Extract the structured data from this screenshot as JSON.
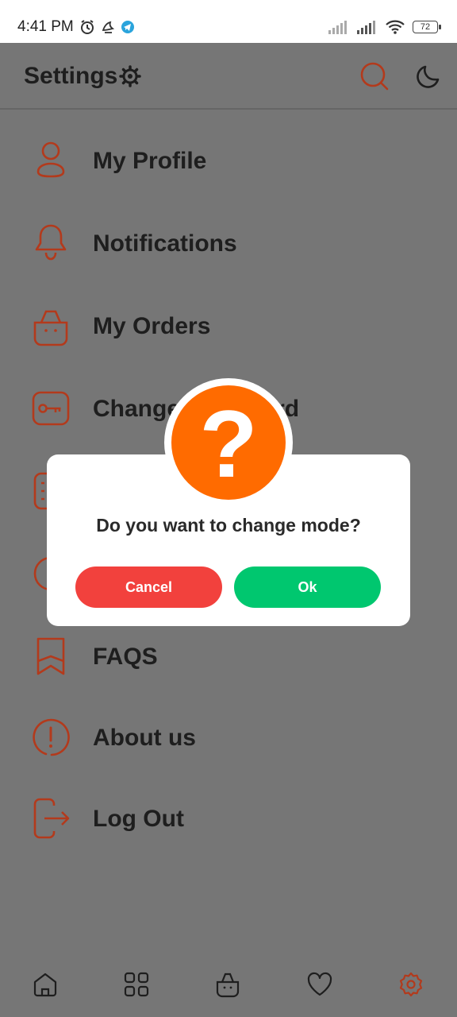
{
  "status_bar": {
    "time": "4:41 PM",
    "battery": "72",
    "icons": [
      "alarm-icon",
      "app-notification-icon",
      "telegram-icon",
      "signal-icon",
      "signal-icon",
      "wifi-icon",
      "battery-icon"
    ]
  },
  "header": {
    "title": "Settings",
    "icons": [
      "gear-icon",
      "search-icon",
      "moon-icon"
    ]
  },
  "menu": {
    "items": [
      {
        "label": "My Profile",
        "icon": "user-icon"
      },
      {
        "label": "Notifications",
        "icon": "bell-icon"
      },
      {
        "label": "My Orders",
        "icon": "bag-icon"
      },
      {
        "label": "Change Password",
        "icon": "key-icon"
      },
      {
        "label": "",
        "icon": "document-icon"
      },
      {
        "label": "",
        "icon": "circle-icon"
      },
      {
        "label": "FAQS",
        "icon": "bookmark-icon"
      },
      {
        "label": "About us",
        "icon": "info-icon"
      },
      {
        "label": "Log Out",
        "icon": "logout-icon"
      }
    ]
  },
  "dialog": {
    "message": "Do you want to change mode?",
    "cancel_label": "Cancel",
    "ok_label": "Ok",
    "badge_glyph": "?"
  },
  "bottom_nav": {
    "items": [
      "home-icon",
      "grid-icon",
      "bag-icon",
      "heart-icon",
      "gear-icon"
    ],
    "active_index": 4
  },
  "colors": {
    "accent": "#b33a1c",
    "overlay": "#767676",
    "cancel": "#f2413d",
    "ok": "#00c76f",
    "badge": "#ff6b00"
  }
}
